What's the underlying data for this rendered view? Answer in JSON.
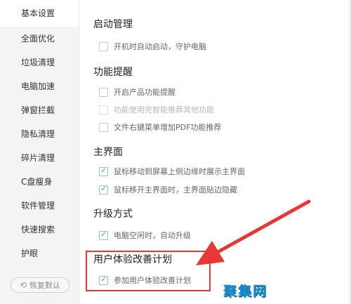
{
  "sidebar": {
    "items": [
      {
        "label": "基本设置"
      },
      {
        "label": "全面优化"
      },
      {
        "label": "垃圾清理"
      },
      {
        "label": "电脑加速"
      },
      {
        "label": "弹窗拦截"
      },
      {
        "label": "隐私清理"
      },
      {
        "label": "碎片清理"
      },
      {
        "label": "C盘瘦身"
      },
      {
        "label": "软件管理"
      },
      {
        "label": "快速搜索"
      },
      {
        "label": "护眼"
      }
    ],
    "restore_label": "恢复默认",
    "restore_icon": "restore-icon"
  },
  "sections": {
    "startup": {
      "title": "启动管理",
      "options": [
        {
          "label": "开机时自动启动，守护电脑",
          "checked": false
        }
      ]
    },
    "reminder": {
      "title": "功能提醒",
      "options": [
        {
          "label": "开启产品功能提醒",
          "checked": false
        },
        {
          "label": "功能使用完智能推荐其他功能",
          "checked": false,
          "disabled": true
        },
        {
          "label": "文件右键菜单增加PDF功能推荐",
          "checked": false
        }
      ]
    },
    "main_ui": {
      "title": "主界面",
      "options": [
        {
          "label": "鼠标移动到屏幕上侧边缘时展示主界面",
          "checked": true
        },
        {
          "label": "鼠标移开主界面时，主界面贴边隐藏",
          "checked": true
        }
      ]
    },
    "upgrade": {
      "title": "升级方式",
      "options": [
        {
          "label": "电脑空闲时，自动升级",
          "checked": true
        }
      ]
    },
    "ux": {
      "title": "用户体验改善计划",
      "options": [
        {
          "label": "参加用户体验改善计划",
          "checked": true
        }
      ]
    }
  },
  "check_mark": "✓",
  "watermark": "聚集网",
  "colors": {
    "highlight": "#e53935",
    "check": "#3aa37a",
    "watermark": "#1e8fcf"
  }
}
